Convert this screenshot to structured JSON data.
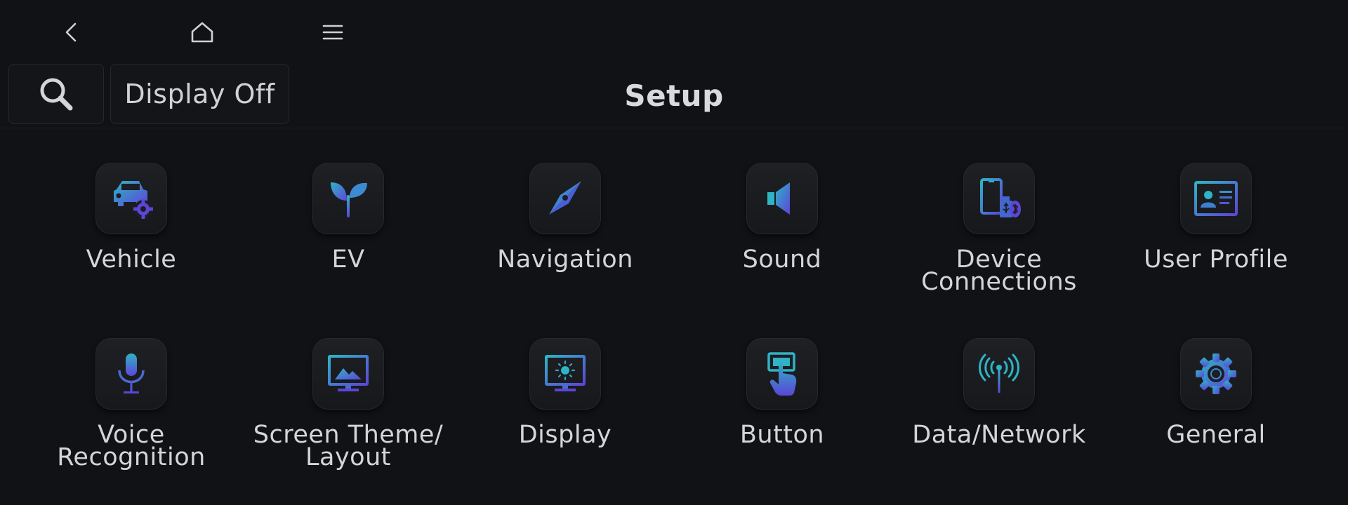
{
  "nav": {
    "back_icon": "chevron-left-icon",
    "home_icon": "home-icon",
    "menu_icon": "hamburger-menu-icon"
  },
  "toolbar": {
    "search_icon": "search-icon",
    "display_off_label": "Display Off",
    "title": "Setup"
  },
  "accent_colors": {
    "teal": "#2fb3c6",
    "violet": "#5b46d8"
  },
  "items": [
    {
      "label": "Vehicle",
      "icon": "car-gear-icon"
    },
    {
      "label": "EV",
      "icon": "sprout-icon"
    },
    {
      "label": "Navigation",
      "icon": "compass-icon"
    },
    {
      "label": "Sound",
      "icon": "speaker-icon"
    },
    {
      "label": "Device\nConnections",
      "icon": "phone-usb-bluetooth-icon"
    },
    {
      "label": "User Profile",
      "icon": "id-card-icon"
    },
    {
      "label": "Voice\nRecognition",
      "icon": "microphone-icon"
    },
    {
      "label": "Screen Theme/\nLayout",
      "icon": "monitor-image-icon"
    },
    {
      "label": "Display",
      "icon": "monitor-brightness-icon"
    },
    {
      "label": "Button",
      "icon": "finger-press-icon"
    },
    {
      "label": "Data/Network",
      "icon": "antenna-signal-icon"
    },
    {
      "label": "General",
      "icon": "gear-icon"
    }
  ]
}
